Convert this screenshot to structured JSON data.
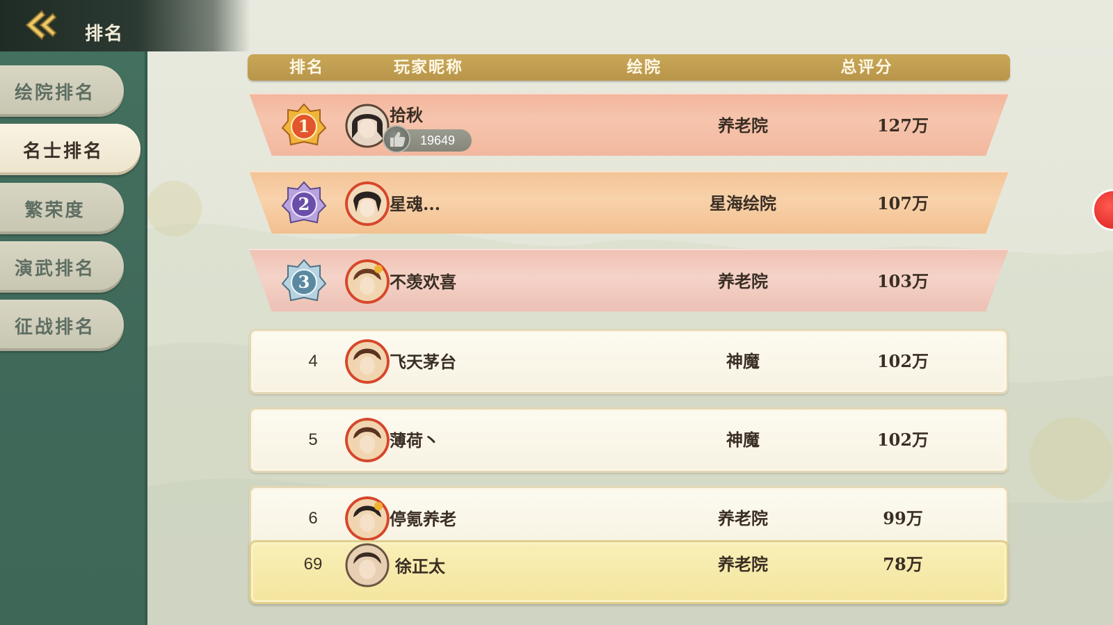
{
  "header": {
    "title": "排名"
  },
  "sidebar": {
    "items": [
      {
        "label": "绘院排名",
        "active": false
      },
      {
        "label": "名士排名",
        "active": true
      },
      {
        "label": "繁荣度",
        "active": false
      },
      {
        "label": "演武排名",
        "active": false
      },
      {
        "label": "征战排名",
        "active": false
      }
    ]
  },
  "table": {
    "columns": [
      "排名",
      "玩家昵称",
      "绘院",
      "总评分"
    ],
    "rows": [
      {
        "rank": "1",
        "nickname": "拾秋",
        "academy": "养老院",
        "score": "127万",
        "likes": "19649"
      },
      {
        "rank": "2",
        "nickname": "星魂...",
        "academy": "星海绘院",
        "score": "107万"
      },
      {
        "rank": "3",
        "nickname": "不羡欢喜",
        "academy": "养老院",
        "score": "103万"
      },
      {
        "rank": "4",
        "nickname": "飞天茅台",
        "academy": "神魔",
        "score": "102万"
      },
      {
        "rank": "5",
        "nickname": "薄荷丶",
        "academy": "神魔",
        "score": "102万"
      },
      {
        "rank": "6",
        "nickname": "停氪养老",
        "academy": "养老院",
        "score": "99万"
      }
    ],
    "self_row": {
      "rank": "69",
      "nickname": "徐正太",
      "academy": "养老院",
      "score": "78万"
    }
  },
  "icons": {
    "back": "back-arrow-icon",
    "like": "thumbs-up-icon",
    "medals": [
      "gold-medal-icon",
      "purple-medal-icon",
      "blue-medal-icon"
    ]
  },
  "colors": {
    "sidebar": "#44705f",
    "header_bar": "#b8954a",
    "rank1": "#f2b59b",
    "rank2": "#f4c395",
    "rank3": "#efc0b2",
    "self_row": "#f4e59f"
  }
}
